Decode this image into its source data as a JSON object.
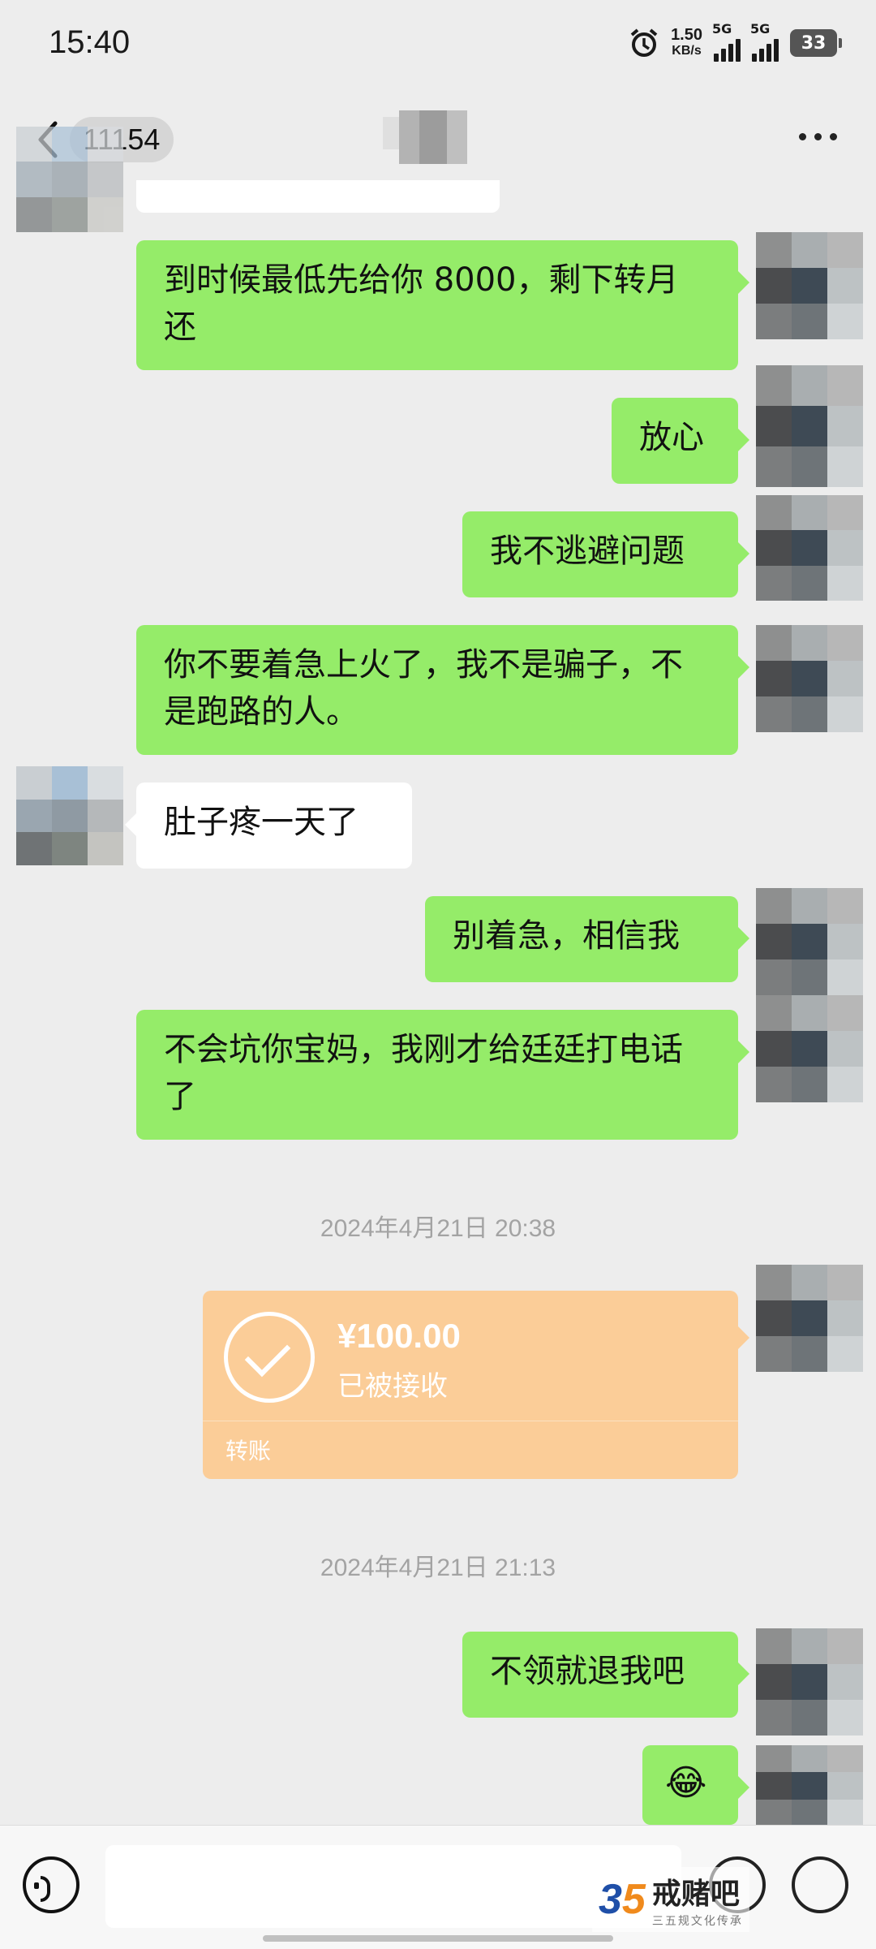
{
  "status_bar": {
    "time": "15:40",
    "net_speed": "1.50",
    "net_unit": "KB/s",
    "sim1": "5G",
    "sim2": "5G",
    "battery": "33"
  },
  "header": {
    "unread_count": "11154"
  },
  "messages": {
    "m1": "到时候最低先给你 8000，剩下转月还",
    "m2": "放心",
    "m3": "我不逃避问题",
    "m4": "你不要着急上火了，我不是骗子，不是跑路的人。",
    "m5": "肚子疼一天了",
    "m6": "别着急，相信我",
    "m7": "不会坑你宝妈，我刚才给廷廷打电话了",
    "ts1": "2024年4月21日 20:38",
    "ts2": "2024年4月21日 21:13",
    "m8": "不领就退我吧",
    "m9": "😂"
  },
  "transfer": {
    "amount": "¥100.00",
    "status": "已被接收",
    "label": "转账"
  },
  "watermark": {
    "logo_a": "3",
    "logo_b": "5",
    "name": "戒赌吧",
    "sub": "三五规文化传承"
  },
  "colors": {
    "sent_bubble": "#95ec69",
    "received_bubble": "#ffffff",
    "transfer_card": "#fbcd98",
    "background": "#ededed"
  }
}
